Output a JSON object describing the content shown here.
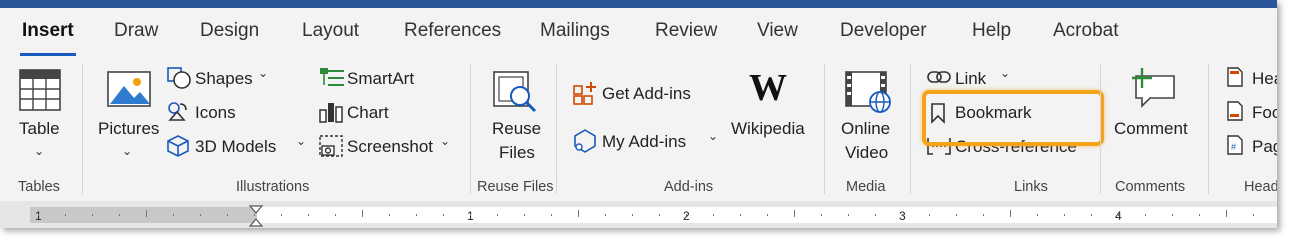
{
  "tabs": [
    "Insert",
    "Draw",
    "Design",
    "Layout",
    "References",
    "Mailings",
    "Review",
    "View",
    "Developer",
    "Help",
    "Acrobat"
  ],
  "groups": {
    "tables": {
      "label": "Tables",
      "table_label": "Table"
    },
    "illustrations": {
      "label": "Illustrations",
      "pictures": "Pictures",
      "shapes": "Shapes",
      "icons": "Icons",
      "models": "3D Models",
      "smartart": "SmartArt",
      "chart": "Chart",
      "screenshot": "Screenshot"
    },
    "reuse": {
      "label": "Reuse Files",
      "reuse_line1": "Reuse",
      "reuse_line2": "Files"
    },
    "addins": {
      "label": "Add-ins",
      "get": "Get Add-ins",
      "my": "My Add-ins",
      "wikipedia": "Wikipedia",
      "wiki_logo": "W"
    },
    "media": {
      "label": "Media",
      "line1": "Online",
      "line2": "Video"
    },
    "links": {
      "label": "Links",
      "link": "Link",
      "bookmark": "Bookmark",
      "crossref": "Cross-reference"
    },
    "comments": {
      "label": "Comments",
      "comment": "Comment"
    },
    "headerfooter": {
      "label": "Head",
      "header": "Hea",
      "footer": "Foo",
      "page": "Pag"
    }
  },
  "ruler": {
    "numbers": [
      "1",
      "1",
      "2",
      "3",
      "4"
    ]
  },
  "colors": {
    "accent": "#2b579a",
    "highlight": "#f5a31a",
    "orange_icon": "#d04a02",
    "green_icon": "#2e8b3a",
    "blue_icon": "#185abd"
  }
}
